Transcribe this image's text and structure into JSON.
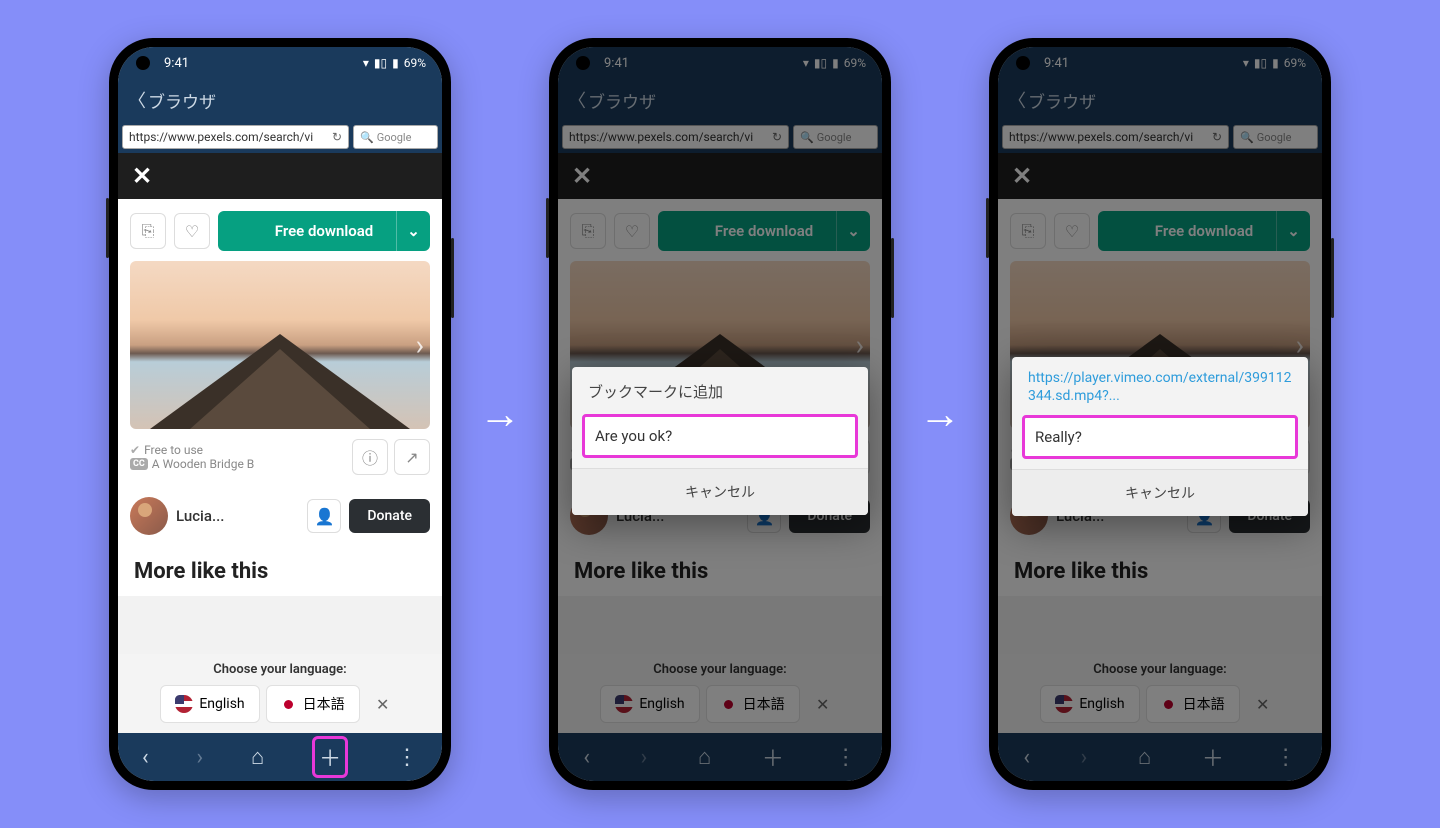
{
  "status": {
    "time": "9:41",
    "battery": "69%"
  },
  "appbar": {
    "title": "ブラウザ"
  },
  "url": "https://www.pexels.com/search/vi",
  "search_placeholder": "Google",
  "download_label": "Free download",
  "meta": {
    "free": "Free to use",
    "caption": "A Wooden Bridge B"
  },
  "author": {
    "name": "Lucia..."
  },
  "donate_label": "Donate",
  "more_like": "More like this",
  "lang": {
    "title": "Choose your language:",
    "en": "English",
    "jp": "日本語"
  },
  "dialog1": {
    "title": "ブックマークに追加",
    "input": "Are you ok?",
    "cancel": "キャンセル"
  },
  "dialog2": {
    "url": "https://player.vimeo.com/external/399112344.sd.mp4?...",
    "input": "Really?",
    "cancel": "キャンセル"
  }
}
